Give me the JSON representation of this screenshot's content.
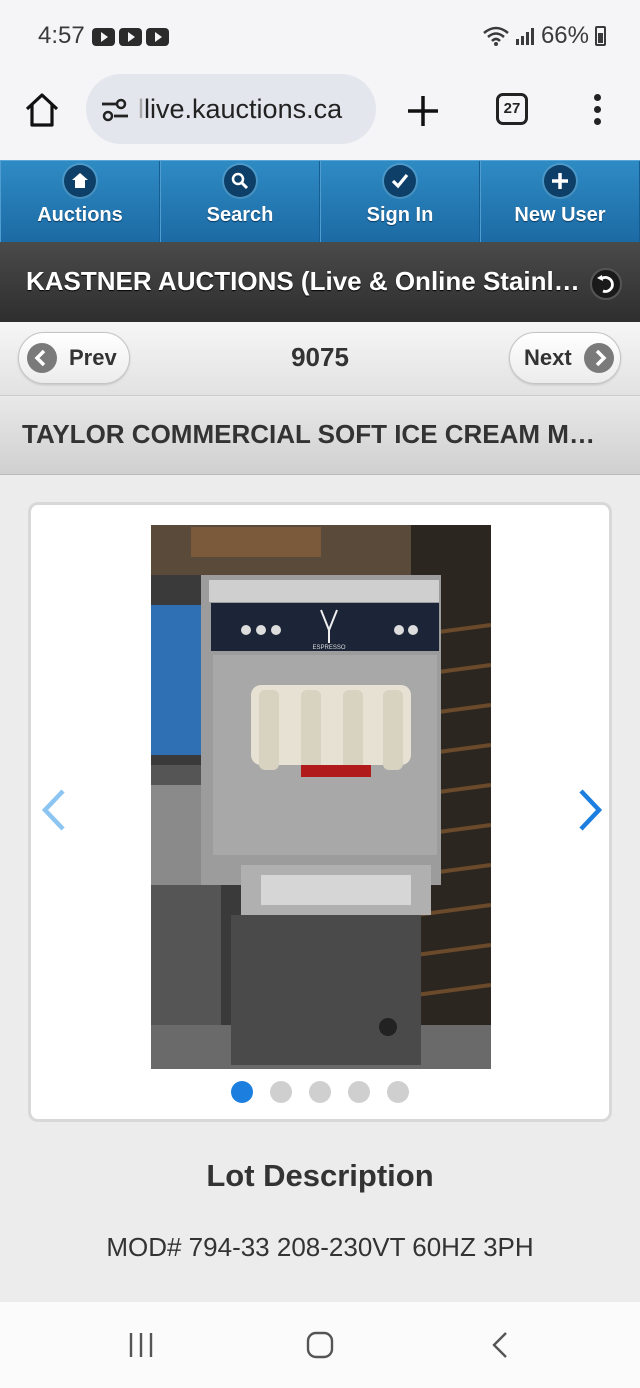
{
  "status_bar": {
    "time": "4:57",
    "battery": "66%",
    "notification_icons": [
      "youtube-icon",
      "youtube-icon",
      "youtube-icon"
    ],
    "system_icons": [
      "wifi-icon",
      "signal-icon",
      "battery-icon"
    ]
  },
  "browser": {
    "url_faded": "l",
    "url": "live.kauctions.ca",
    "tab_count": "27"
  },
  "nav": {
    "items": [
      {
        "label": "Auctions",
        "icon": "home-icon"
      },
      {
        "label": "Search",
        "icon": "search-icon"
      },
      {
        "label": "Sign In",
        "icon": "check-icon"
      },
      {
        "label": "New User",
        "icon": "plus-icon"
      }
    ],
    "color": "#2b82bf"
  },
  "header": {
    "title": "KASTNER AUCTIONS (Live & Online Stainless Steel Restaurant Equipment Auction)"
  },
  "pager": {
    "prev_label": "Prev",
    "next_label": "Next",
    "lot_number": "9075"
  },
  "lot": {
    "title": "TAYLOR COMMERCIAL SOFT ICE CREAM MACHINE",
    "photo_count": 5,
    "active_photo": 1,
    "description_heading": "Lot Description",
    "description": "MOD# 794-33 208-230VT 60HZ 3PH",
    "machine_logo_text": "ESPRESSO"
  },
  "colors": {
    "accent": "#1c7fe0",
    "header_dark": "#3a3a3a"
  }
}
